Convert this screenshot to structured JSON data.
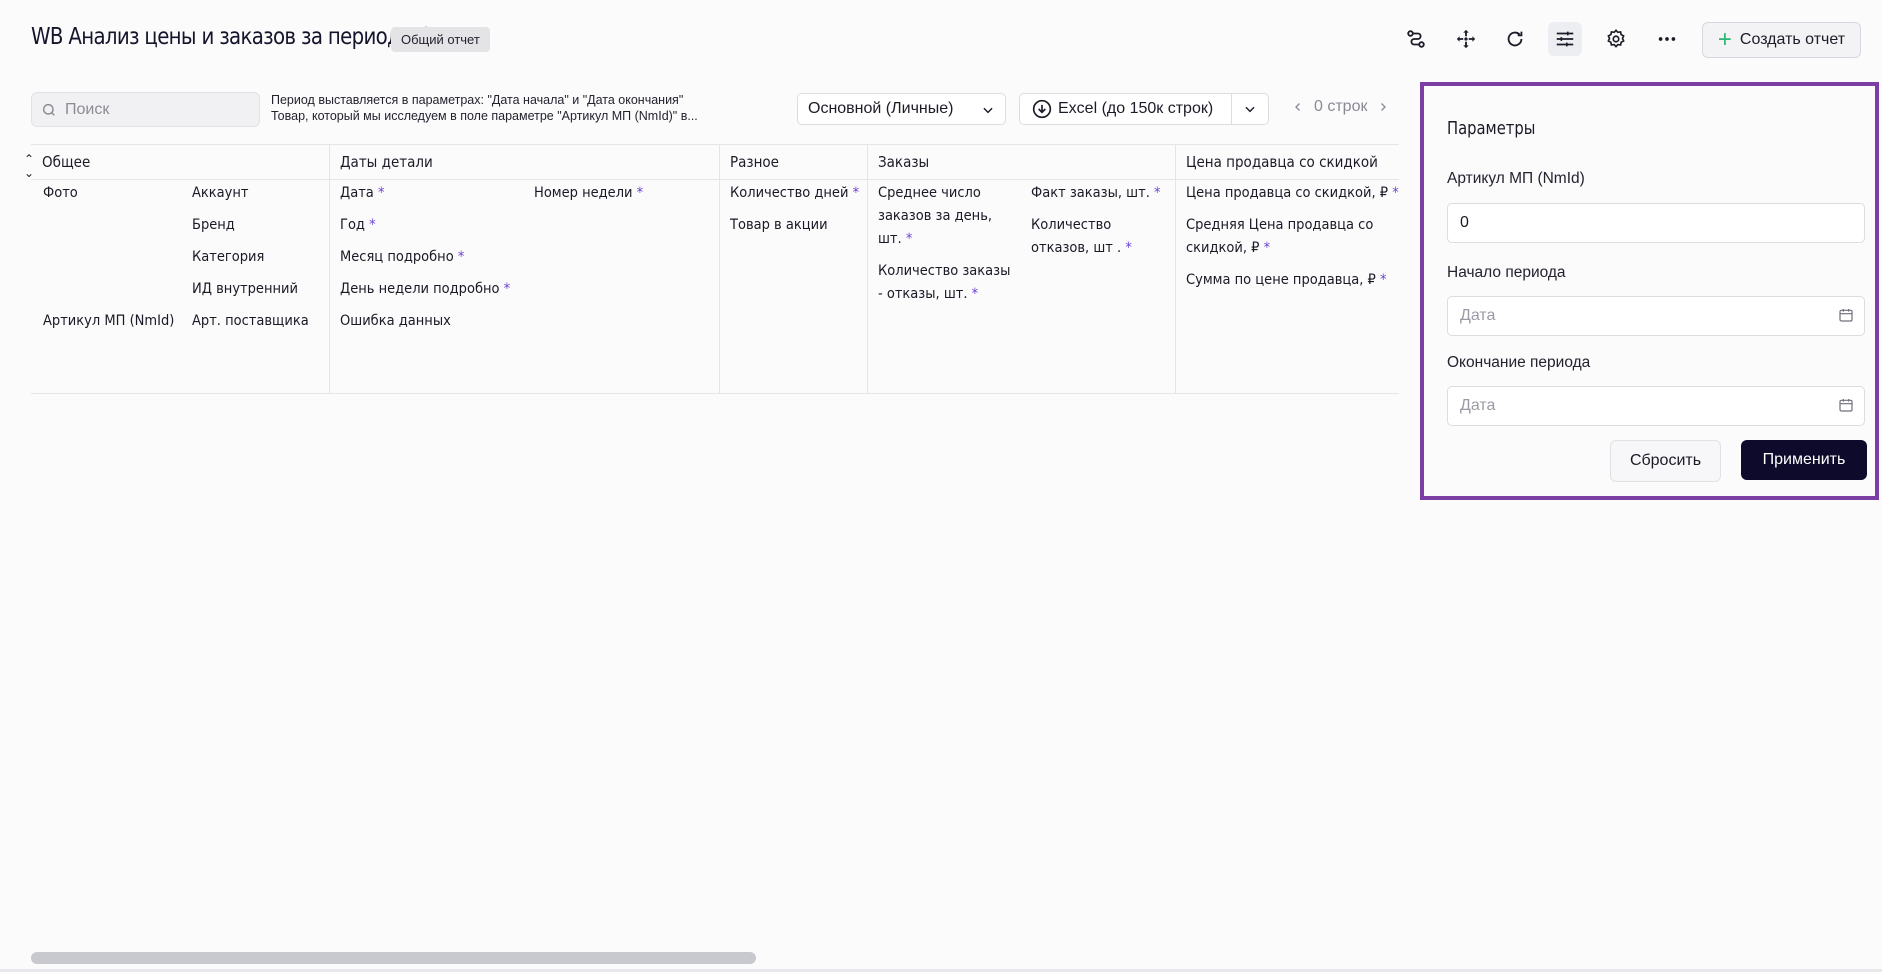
{
  "header": {
    "title": "WB Анализ цены и заказов за период v.2",
    "badge": "Общий отчет",
    "icons": [
      "flow-icon",
      "move-icon",
      "refresh-icon",
      "filters-icon",
      "gear-icon",
      "more-icon"
    ],
    "create_label": "Создать отчет"
  },
  "toolbar": {
    "search_placeholder": "Поиск",
    "description_line1": "Период выставляется в параметрах: \"Дата начала\" и \"Дата окончания\"",
    "description_line2": "Товар, который мы исследуем в поле параметре \"Артикул МП (NmId)\" в...",
    "view_select": "Основной (Личные)",
    "excel_label": "Excel (до 150к строк)",
    "rows_count": "0 строк"
  },
  "groups": [
    {
      "title": "Общее",
      "fields": [
        {
          "label": "Фото",
          "req": false
        },
        {
          "label": "Аккаунт",
          "req": false
        },
        {
          "label": "Бренд",
          "req": false
        },
        {
          "label": "Категория",
          "req": false
        },
        {
          "label": "ИД внутренний",
          "req": false
        },
        {
          "label": "Артикул МП (NmId)",
          "req": false
        },
        {
          "label": "Арт. поставщика",
          "req": false
        }
      ]
    },
    {
      "title": "Даты детали",
      "fields": [
        {
          "label": "Дата",
          "req": true
        },
        {
          "label": "Номер недели",
          "req": true
        },
        {
          "label": "Год",
          "req": true
        },
        {
          "label": "Месяц подробно",
          "req": true
        },
        {
          "label": "День недели подробно",
          "req": true
        },
        {
          "label": "Ошибка данных",
          "req": false
        }
      ]
    },
    {
      "title": "Разное",
      "fields": [
        {
          "label": "Количество дней",
          "req": true
        },
        {
          "label": "Товар в акции",
          "req": false
        }
      ]
    },
    {
      "title": "Заказы",
      "fields": [
        {
          "label": "Среднее число заказов за день, шт.",
          "req": true
        },
        {
          "label": "Факт заказы, шт.",
          "req": true
        },
        {
          "label": "Количество отказов, шт .",
          "req": true
        },
        {
          "label": "Количество заказы - отказы, шт.",
          "req": true
        }
      ]
    },
    {
      "title": "Цена продавца со скидкой",
      "fields": [
        {
          "label": "Цена продавца со скидкой, ₽",
          "req": true
        },
        {
          "label": "Средняя Цена продавца со скидкой, ₽",
          "req": true
        },
        {
          "label": "Сумма по цене продавца, ₽",
          "req": true
        }
      ]
    }
  ],
  "req_mark": "*",
  "params": {
    "title": "Параметры",
    "article_label": "Артикул МП (NmId)",
    "article_value": "0",
    "start_label": "Начало периода",
    "start_placeholder": "Дата",
    "end_label": "Окончание периода",
    "end_placeholder": "Дата",
    "reset_label": "Сбросить",
    "apply_label": "Применить"
  },
  "colors": {
    "accent": "#7b3fa3",
    "apply_bg": "#0d0a2b",
    "required": "#6b3fd6",
    "plus": "#2bb673"
  }
}
